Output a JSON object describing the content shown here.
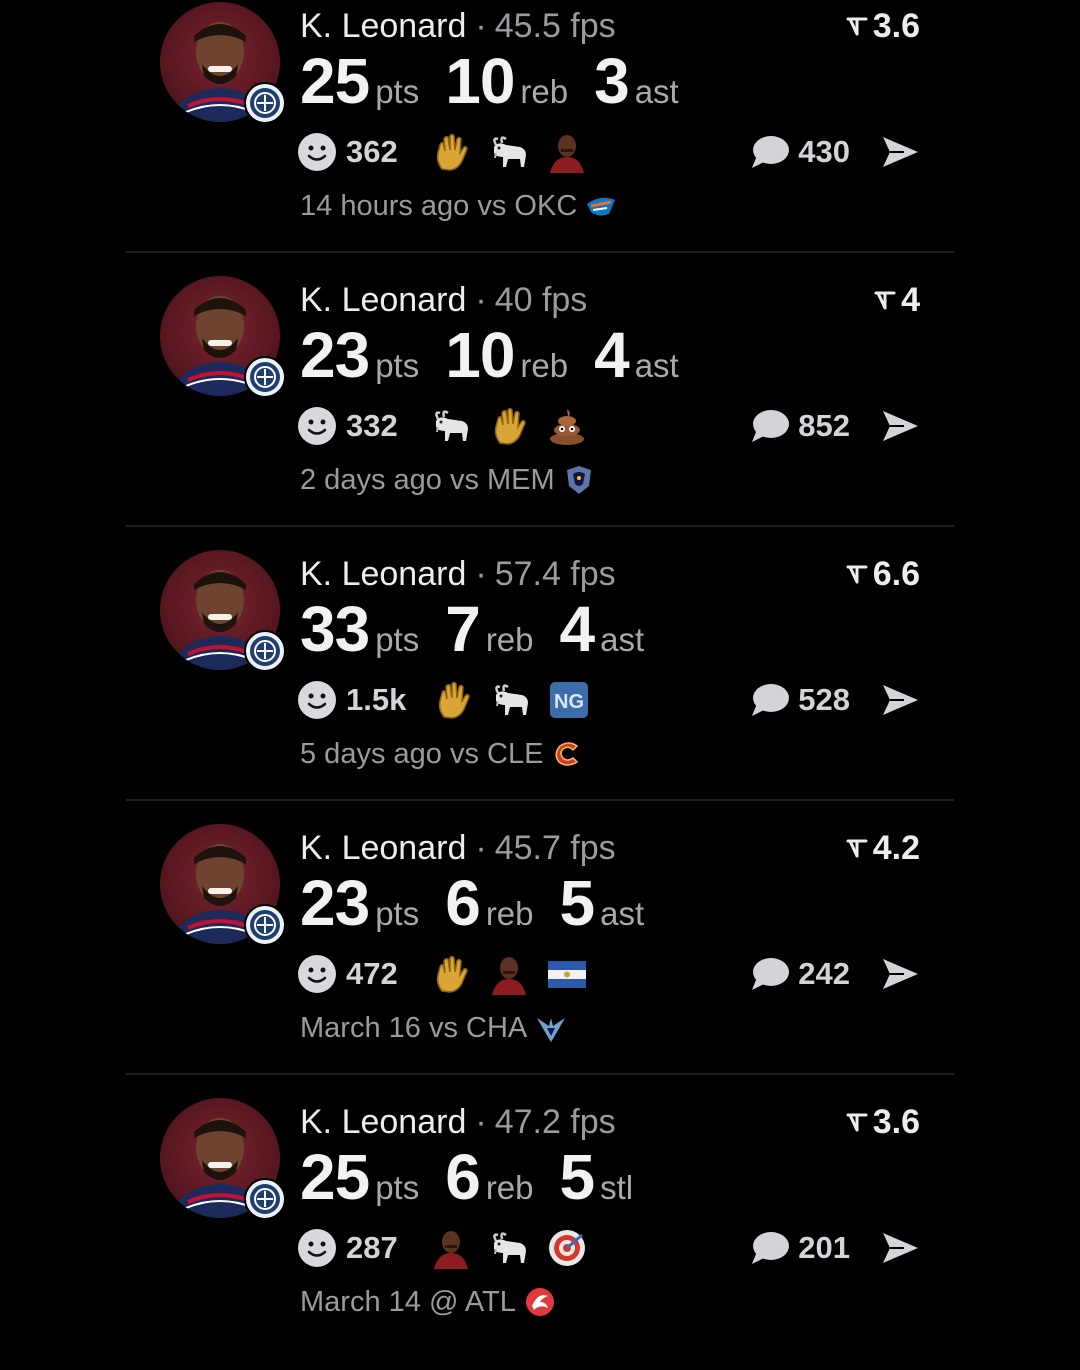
{
  "posts": [
    {
      "player": "K. Leonard",
      "fps": "45.5 fps",
      "rating": "3.6",
      "stats": [
        {
          "value": "25",
          "label": "pts"
        },
        {
          "value": "10",
          "label": "reb"
        },
        {
          "value": "3",
          "label": "ast"
        }
      ],
      "reaction_count": "362",
      "reactions": [
        "raised-hand-icon",
        "goat-icon",
        "player-face-icon"
      ],
      "comment_count": "430",
      "meta": "14 hours ago vs OKC",
      "opponent_logo": "okc-logo-icon"
    },
    {
      "player": "K. Leonard",
      "fps": "40 fps",
      "rating": "4",
      "stats": [
        {
          "value": "23",
          "label": "pts"
        },
        {
          "value": "10",
          "label": "reb"
        },
        {
          "value": "4",
          "label": "ast"
        }
      ],
      "reaction_count": "332",
      "reactions": [
        "goat-icon",
        "raised-hand-icon",
        "poop-icon"
      ],
      "comment_count": "852",
      "meta": "2 days ago vs MEM",
      "opponent_logo": "mem-logo-icon"
    },
    {
      "player": "K. Leonard",
      "fps": "57.4 fps",
      "rating": "6.6",
      "stats": [
        {
          "value": "33",
          "label": "pts"
        },
        {
          "value": "7",
          "label": "reb"
        },
        {
          "value": "4",
          "label": "ast"
        }
      ],
      "reaction_count": "1.5k",
      "reactions": [
        "raised-hand-icon",
        "goat-icon",
        "ng-badge-icon"
      ],
      "ng_text": "NG",
      "comment_count": "528",
      "meta": "5 days ago vs CLE",
      "opponent_logo": "cle-logo-icon"
    },
    {
      "player": "K. Leonard",
      "fps": "45.7 fps",
      "rating": "4.2",
      "stats": [
        {
          "value": "23",
          "label": "pts"
        },
        {
          "value": "6",
          "label": "reb"
        },
        {
          "value": "5",
          "label": "ast"
        }
      ],
      "reaction_count": "472",
      "reactions": [
        "raised-hand-icon",
        "player-face-icon",
        "el-salvador-flag-icon"
      ],
      "comment_count": "242",
      "meta": "March 16 vs CHA",
      "opponent_logo": "cha-logo-icon"
    },
    {
      "player": "K. Leonard",
      "fps": "47.2 fps",
      "rating": "3.6",
      "stats": [
        {
          "value": "25",
          "label": "pts"
        },
        {
          "value": "6",
          "label": "reb"
        },
        {
          "value": "5",
          "label": "stl"
        }
      ],
      "reaction_count": "287",
      "reactions": [
        "player-face-icon",
        "goat-icon",
        "bullseye-icon"
      ],
      "comment_count": "201",
      "meta": "March 14 @ ATL",
      "opponent_logo": "atl-logo-icon"
    }
  ],
  "colors": {
    "background": "#000000",
    "primary_text": "#ededed",
    "secondary_text": "#9a9a9f",
    "avatar_bg": "#5b1822"
  }
}
